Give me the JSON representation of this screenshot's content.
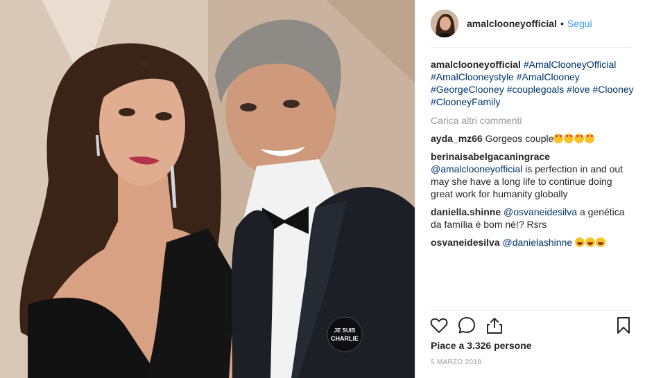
{
  "post": {
    "username": "amalclooneyofficial",
    "separator": "•",
    "follow_label": "Segui",
    "caption": {
      "username": "amalclooneyofficial",
      "hashtags": [
        "#AmalClooneyOfficial",
        "#AmalClooneystyle",
        "#AmalClooney",
        "#GeorgeClooney",
        "#couplegoals",
        "#love",
        "#Clooney",
        "#ClooneyFamily"
      ]
    },
    "load_more_label": "Carica altri commenti",
    "comments": [
      {
        "username": "ayda_mz66",
        "text": "Gorgeos couple",
        "emoji": [
          "heart-eyes",
          "heart-eyes",
          "heart-eyes",
          "heart-eyes"
        ]
      },
      {
        "username": "berinaisabelgacaningrace",
        "mention": "@amalclooneyofficial",
        "text": "is perfection in and out may she have a long life to continue doing great work for humanity globally"
      },
      {
        "username": "daniella.shinne",
        "mention": "@osvaneidesilva",
        "text": "a genética da família é bom né!? Rsrs"
      },
      {
        "username": "osvaneidesilva",
        "mention": "@danielashinne",
        "text": "",
        "emoji": [
          "laugh",
          "laugh",
          "laugh"
        ]
      }
    ],
    "likes": "Piace a 3.326 persone",
    "date": "5 MARZO 2018",
    "photo_badge": {
      "line1": "JE SUIS",
      "line2": "CHARLIE"
    }
  },
  "icons": [
    "heart-icon",
    "comment-icon",
    "share-icon",
    "bookmark-icon"
  ]
}
